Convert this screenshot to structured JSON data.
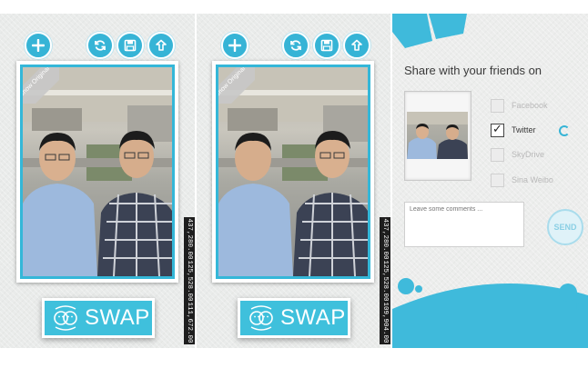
{
  "screens": [
    {
      "toolbar": {
        "add_icon": "plus-icon",
        "refresh_icon": "refresh-icon",
        "save_icon": "floppy-disk-icon",
        "share_icon": "share-icon"
      },
      "ribbon_label": "Show Original",
      "coords": [
        "437,280.00",
        "125,528.00",
        "111,672.00"
      ],
      "swap_label": "SWAP"
    },
    {
      "toolbar": {
        "add_icon": "plus-icon",
        "refresh_icon": "refresh-icon",
        "save_icon": "floppy-disk-icon",
        "share_icon": "share-icon"
      },
      "ribbon_label": "Show Original",
      "coords": [
        "437,280.00",
        "125,528.00",
        "109,904.00"
      ],
      "swap_label": "SWAP"
    }
  ],
  "share": {
    "title": "Share with your friends on",
    "networks": [
      {
        "label": "Facebook",
        "checked": false
      },
      {
        "label": "Twitter",
        "checked": true
      },
      {
        "label": "SkyDrive",
        "checked": false
      },
      {
        "label": "Sina Weibo",
        "checked": false
      }
    ],
    "comment_placeholder": "Leave some comments ...",
    "send_label": "SEND"
  },
  "colors": {
    "accent": "#36b4d6",
    "panel_bg": "#e9ebea"
  }
}
